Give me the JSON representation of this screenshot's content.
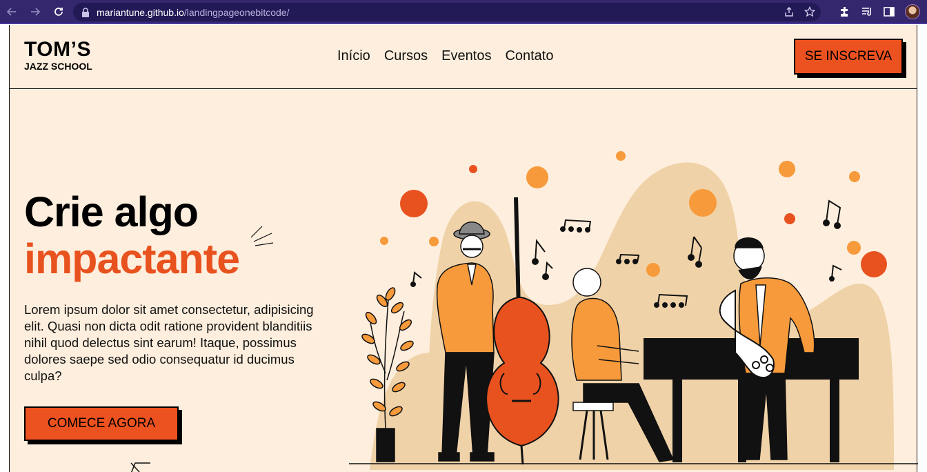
{
  "browser": {
    "url_host": "mariantune.github.io",
    "url_path": "/landingpageonebitcode/",
    "icons": [
      "back-icon",
      "forward-icon",
      "reload-icon",
      "lock-icon",
      "share-icon",
      "star-icon",
      "extensions-icon",
      "media-icon",
      "sidepanel-icon",
      "profile-avatar"
    ]
  },
  "header": {
    "logo_main": "TOM’S",
    "logo_sub": "JAZZ SCHOOL",
    "nav": [
      "Início",
      "Cursos",
      "Eventos",
      "Contato"
    ],
    "signup_label": "SE INSCREVA"
  },
  "hero": {
    "title_line1": "Crie algo",
    "title_line2": "impactante",
    "body": "Lorem ipsum dolor sit amet consectetur, adipisicing elit. Quasi non dicta odit ratione provident blanditiis nihil quod delectus sint earum! Itaque, possimus dolores saepe sed odio consequatur id ducimus culpa?",
    "cta_label": "COMECE AGORA"
  },
  "colors": {
    "background": "#feeedd",
    "accent": "#ec521f",
    "chrome": "#35276e",
    "blob": "#f0d2a8",
    "light_orange": "#f69a3b"
  }
}
